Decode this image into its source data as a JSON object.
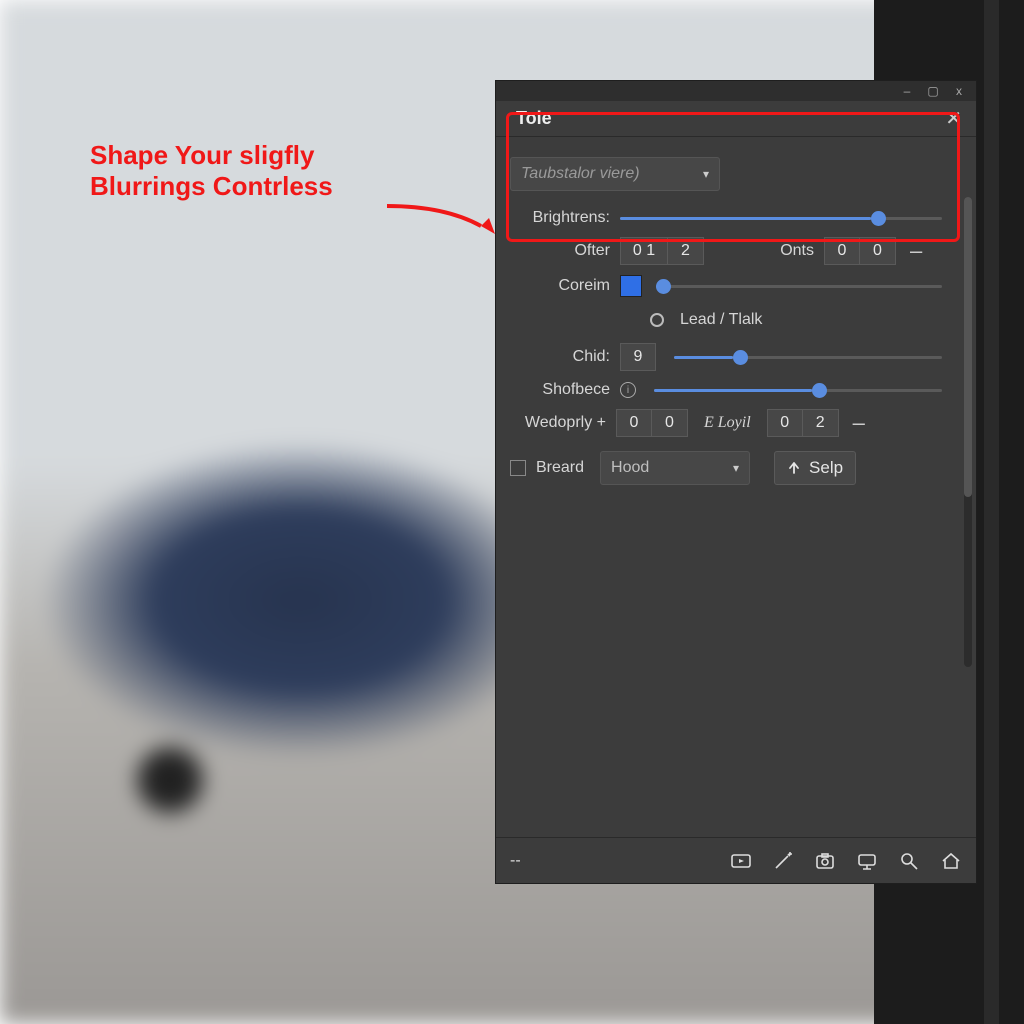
{
  "annotation": {
    "line1": "Shape Your sligfly",
    "line2": "Blurrings Contrless"
  },
  "window": {
    "minimize": "–",
    "maximize": "▢",
    "close": "x"
  },
  "panel": {
    "tab_label": "Tole",
    "tab_close": "✕",
    "preset_placeholder": "Taubstalor viere)",
    "brightness_label": "Brightrens:",
    "ofter_label": "Ofter",
    "ofter_a": "0 1",
    "ofter_b": "2",
    "onts_label": "Onts",
    "onts_a": "0",
    "onts_b": "0",
    "coreim_label": "Coreim",
    "lead_label": "Lead / Tlalk",
    "chid_label": "Chid:",
    "chid_value": "9",
    "shofbece_label": "Shofbece",
    "wedoprly_label": "Wedoprly +",
    "wedoprly_a": "0",
    "wedoprly_b": "0",
    "loyil_label": "E  Loyil",
    "loyil_a": "0",
    "loyil_b": "2",
    "breard_label": "Breard",
    "breard_value": "Hood",
    "selp_label": "Selp",
    "footer_left": "--"
  }
}
